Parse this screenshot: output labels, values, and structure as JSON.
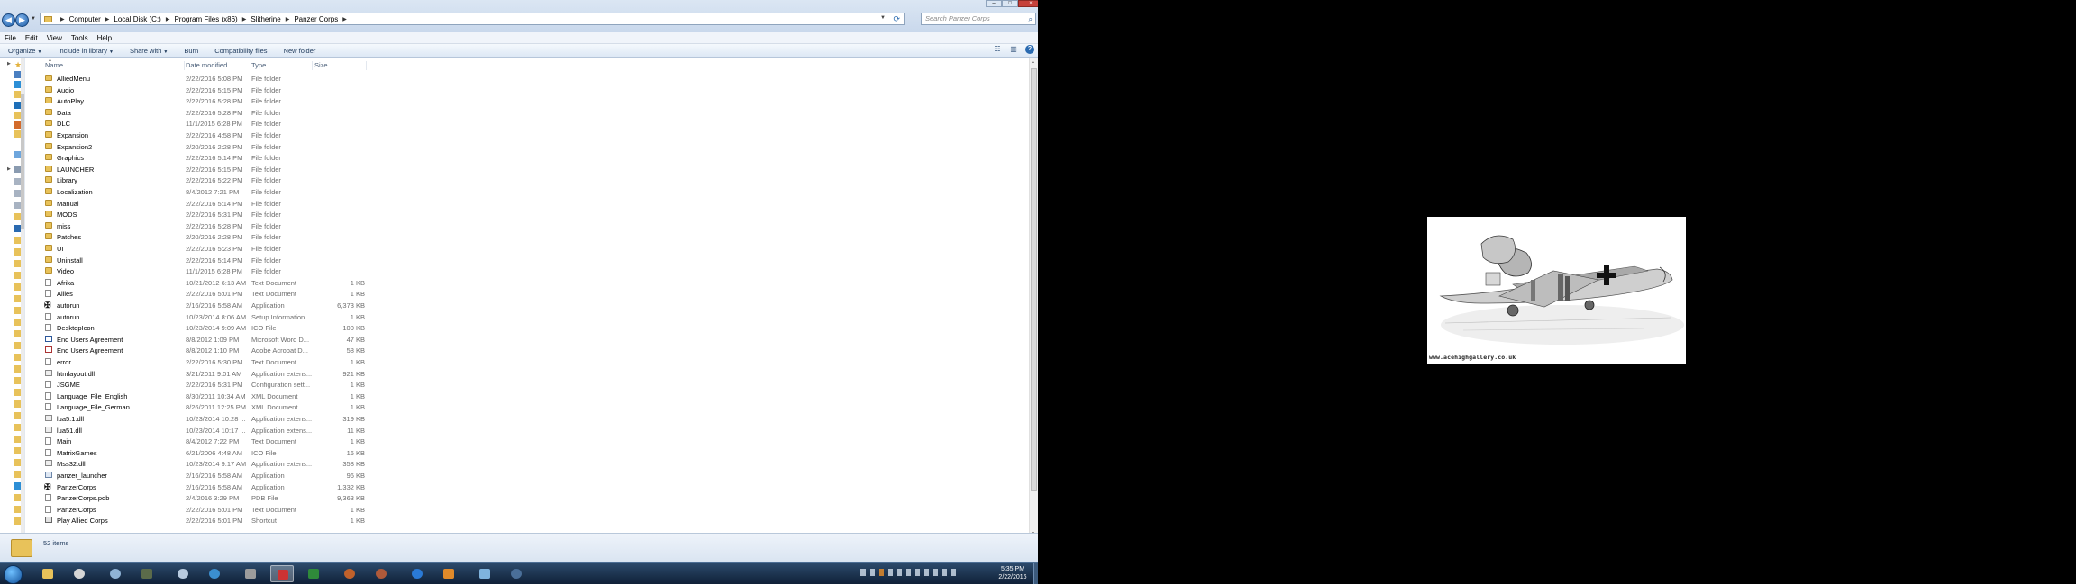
{
  "window": {
    "breadcrumb": [
      "Computer",
      "Local Disk (C:)",
      "Program Files (x86)",
      "Slitherine",
      "Panzer Corps"
    ],
    "search_placeholder": "Search Panzer Corps"
  },
  "menubar": [
    "File",
    "Edit",
    "View",
    "Tools",
    "Help"
  ],
  "toolbar": {
    "organize": "Organize",
    "include": "Include in library",
    "share": "Share with",
    "burn": "Burn",
    "compat": "Compatibility files",
    "newfolder": "New folder"
  },
  "columns": {
    "name": "Name",
    "date": "Date modified",
    "type": "Type",
    "size": "Size"
  },
  "files": [
    {
      "name": "AlliedMenu",
      "date": "2/22/2016 5:08 PM",
      "type": "File folder",
      "size": "",
      "icon": "folder"
    },
    {
      "name": "Audio",
      "date": "2/22/2016 5:15 PM",
      "type": "File folder",
      "size": "",
      "icon": "folder"
    },
    {
      "name": "AutoPlay",
      "date": "2/22/2016 5:28 PM",
      "type": "File folder",
      "size": "",
      "icon": "folder"
    },
    {
      "name": "Data",
      "date": "2/22/2016 5:28 PM",
      "type": "File folder",
      "size": "",
      "icon": "folder"
    },
    {
      "name": "DLC",
      "date": "11/1/2015 6:28 PM",
      "type": "File folder",
      "size": "",
      "icon": "folder"
    },
    {
      "name": "Expansion",
      "date": "2/22/2016 4:58 PM",
      "type": "File folder",
      "size": "",
      "icon": "folder"
    },
    {
      "name": "Expansion2",
      "date": "2/20/2016 2:28 PM",
      "type": "File folder",
      "size": "",
      "icon": "folder"
    },
    {
      "name": "Graphics",
      "date": "2/22/2016 5:14 PM",
      "type": "File folder",
      "size": "",
      "icon": "folder"
    },
    {
      "name": "LAUNCHER",
      "date": "2/22/2016 5:15 PM",
      "type": "File folder",
      "size": "",
      "icon": "folder"
    },
    {
      "name": "Library",
      "date": "2/22/2016 5:22 PM",
      "type": "File folder",
      "size": "",
      "icon": "folder"
    },
    {
      "name": "Localization",
      "date": "8/4/2012 7:21 PM",
      "type": "File folder",
      "size": "",
      "icon": "folder"
    },
    {
      "name": "Manual",
      "date": "2/22/2016 5:14 PM",
      "type": "File folder",
      "size": "",
      "icon": "folder"
    },
    {
      "name": "MODS",
      "date": "2/22/2016 5:31 PM",
      "type": "File folder",
      "size": "",
      "icon": "folder"
    },
    {
      "name": "miss",
      "date": "2/22/2016 5:28 PM",
      "type": "File folder",
      "size": "",
      "icon": "folder"
    },
    {
      "name": "Patches",
      "date": "2/20/2016 2:28 PM",
      "type": "File folder",
      "size": "",
      "icon": "folder"
    },
    {
      "name": "UI",
      "date": "2/22/2016 5:23 PM",
      "type": "File folder",
      "size": "",
      "icon": "folder"
    },
    {
      "name": "Uninstall",
      "date": "2/22/2016 5:14 PM",
      "type": "File folder",
      "size": "",
      "icon": "folder"
    },
    {
      "name": "Video",
      "date": "11/1/2015 6:28 PM",
      "type": "File folder",
      "size": "",
      "icon": "folder"
    },
    {
      "name": "Afrika",
      "date": "10/21/2012 6:13 AM",
      "type": "Text Document",
      "size": "1 KB",
      "icon": "doc"
    },
    {
      "name": "Allies",
      "date": "2/22/2016 5:01 PM",
      "type": "Text Document",
      "size": "1 KB",
      "icon": "doc"
    },
    {
      "name": "autorun",
      "date": "2/16/2016 5:58 AM",
      "type": "Application",
      "size": "6,373 KB",
      "icon": "cross"
    },
    {
      "name": "autorun",
      "date": "10/23/2014 8:06 AM",
      "type": "Setup Information",
      "size": "1 KB",
      "icon": "doc"
    },
    {
      "name": "DesktopIcon",
      "date": "10/23/2014 9:09 AM",
      "type": "ICO File",
      "size": "100 KB",
      "icon": "doc"
    },
    {
      "name": "End Users Agreement",
      "date": "8/8/2012 1:09 PM",
      "type": "Microsoft Word D...",
      "size": "47 KB",
      "icon": "word"
    },
    {
      "name": "End Users Agreement",
      "date": "8/8/2012 1:10 PM",
      "type": "Adobe Acrobat D...",
      "size": "58 KB",
      "icon": "pdf"
    },
    {
      "name": "error",
      "date": "2/22/2016 5:30 PM",
      "type": "Text Document",
      "size": "1 KB",
      "icon": "doc"
    },
    {
      "name": "htmlayout.dll",
      "date": "3/21/2011 9:01 AM",
      "type": "Application extens...",
      "size": "921 KB",
      "icon": "dll"
    },
    {
      "name": "JSGME",
      "date": "2/22/2016 5:31 PM",
      "type": "Configuration sett...",
      "size": "1 KB",
      "icon": "doc"
    },
    {
      "name": "Language_File_English",
      "date": "8/30/2011 10:34 AM",
      "type": "XML Document",
      "size": "1 KB",
      "icon": "doc"
    },
    {
      "name": "Language_File_German",
      "date": "8/26/2011 12:25 PM",
      "type": "XML Document",
      "size": "1 KB",
      "icon": "doc"
    },
    {
      "name": "lua5.1.dll",
      "date": "10/23/2014 10:28 ...",
      "type": "Application extens...",
      "size": "319 KB",
      "icon": "dll"
    },
    {
      "name": "lua51.dll",
      "date": "10/23/2014 10:17 ...",
      "type": "Application extens...",
      "size": "11 KB",
      "icon": "dll"
    },
    {
      "name": "Main",
      "date": "8/4/2012 7:22 PM",
      "type": "Text Document",
      "size": "1 KB",
      "icon": "doc"
    },
    {
      "name": "MatrixGames",
      "date": "6/21/2006 4:48 AM",
      "type": "ICO File",
      "size": "16 KB",
      "icon": "doc"
    },
    {
      "name": "Mss32.dll",
      "date": "10/23/2014 9:17 AM",
      "type": "Application extens...",
      "size": "358 KB",
      "icon": "dll"
    },
    {
      "name": "panzer_launcher",
      "date": "2/16/2016 5:58 AM",
      "type": "Application",
      "size": "96 KB",
      "icon": "app"
    },
    {
      "name": "PanzerCorps",
      "date": "2/16/2016 5:58 AM",
      "type": "Application",
      "size": "1,332 KB",
      "icon": "cross"
    },
    {
      "name": "PanzerCorps.pdb",
      "date": "2/4/2016 3:29 PM",
      "type": "PDB File",
      "size": "9,363 KB",
      "icon": "doc"
    },
    {
      "name": "PanzerCorps",
      "date": "2/22/2016 5:01 PM",
      "type": "Text Document",
      "size": "1 KB",
      "icon": "doc"
    },
    {
      "name": "Play Allied Corps",
      "date": "2/22/2016 5:01 PM",
      "type": "Shortcut",
      "size": "1 KB",
      "icon": "shortcut"
    }
  ],
  "status": {
    "items": "52 items"
  },
  "clock": {
    "time": "5:35 PM",
    "date": "2/22/2016"
  },
  "painting": {
    "watermark": "www.acehighgallery.co.uk"
  },
  "colors": {
    "folder": "#e8c25a",
    "toolbar_text": "#1e395b",
    "taskbar": "#1b3350"
  }
}
